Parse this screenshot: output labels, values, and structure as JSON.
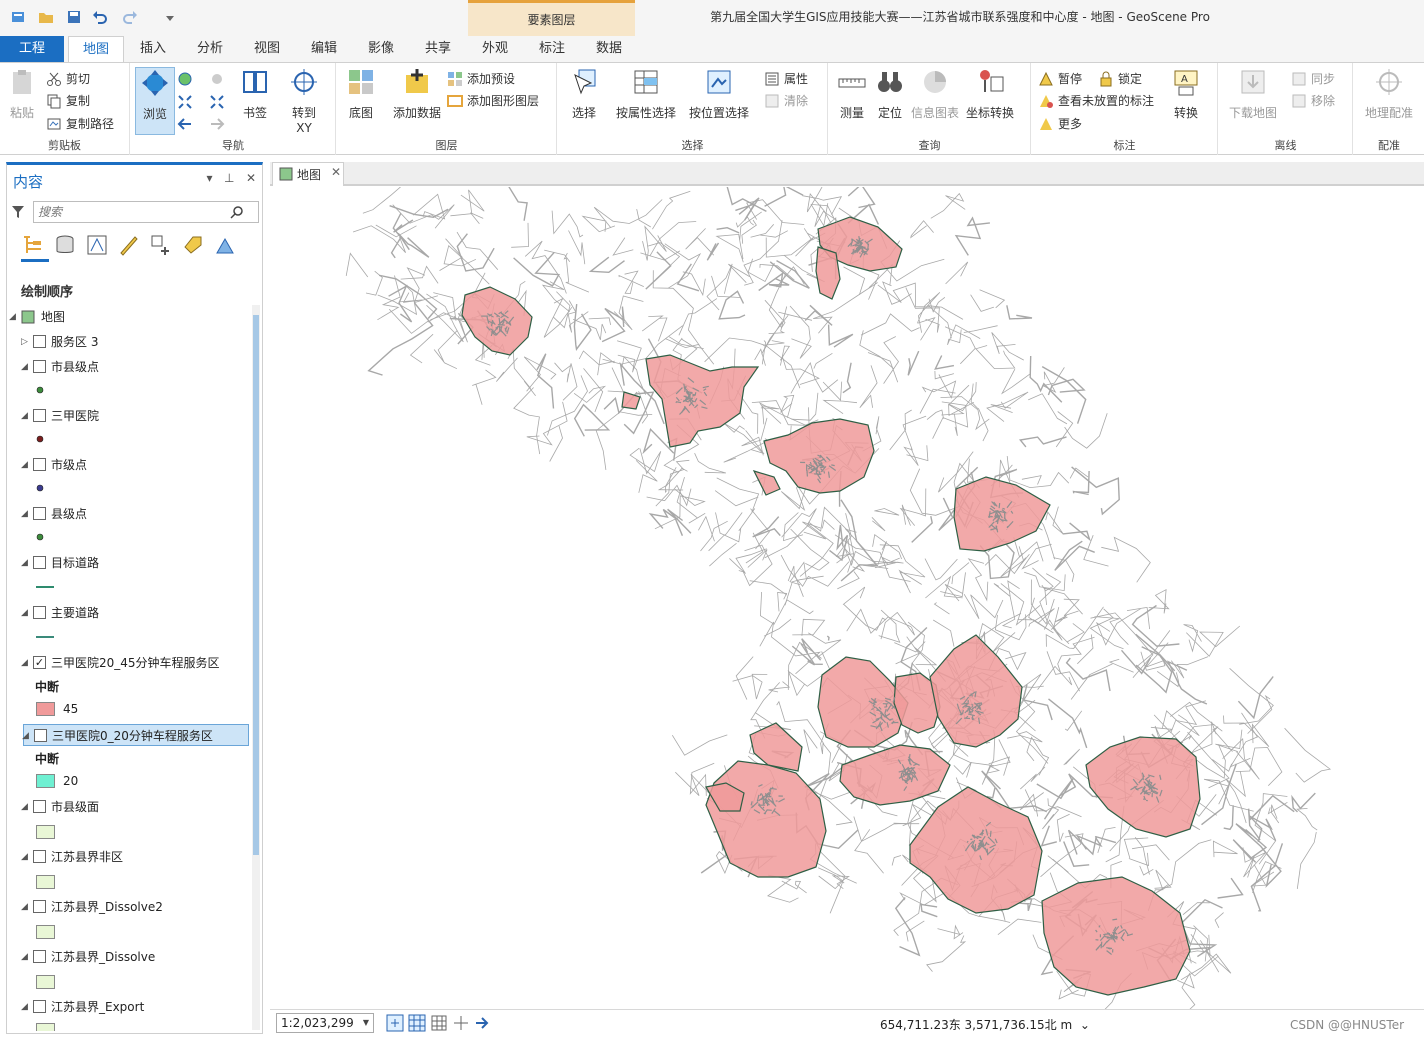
{
  "window": {
    "title": "第九届全国大学生GIS应用技能大赛——江苏省城市联系强度和中心度 - 地图 - GeoScene Pro",
    "contextual_band": "要素图层"
  },
  "tabs": [
    {
      "label": "工程"
    },
    {
      "label": "地图"
    },
    {
      "label": "插入"
    },
    {
      "label": "分析"
    },
    {
      "label": "视图"
    },
    {
      "label": "编辑"
    },
    {
      "label": "影像"
    },
    {
      "label": "共享"
    },
    {
      "label": "外观"
    },
    {
      "label": "标注"
    },
    {
      "label": "数据"
    }
  ],
  "ribbon": {
    "clipboard": {
      "paste": "粘贴",
      "cut": "剪切",
      "copy": "复制",
      "copy_path": "复制路径",
      "group": "剪贴板"
    },
    "navigate": {
      "explore": "浏览",
      "bookmarks": "书签",
      "goto_xy_line1": "转到",
      "goto_xy_line2": "XY",
      "group": "导航"
    },
    "layer": {
      "basemap": "底图",
      "add_data": "添加数据",
      "add_preset": "添加预设",
      "add_graphics": "添加图形图层",
      "group": "图层"
    },
    "selection": {
      "select": "选择",
      "by_attr": "按属性选择",
      "by_loc": "按位置选择",
      "attributes": "属性",
      "clear": "清除",
      "group": "选择"
    },
    "inquiry": {
      "measure": "测量",
      "locate": "定位",
      "infographics": "信息图表",
      "convert_coord": "坐标转换",
      "group": "查询"
    },
    "labeling": {
      "pause": "暂停",
      "lock": "锁定",
      "unplaced": "查看未放置的标注",
      "more": "更多",
      "convert": "转换",
      "group": "标注"
    },
    "offline": {
      "download": "下载地图",
      "sync": "同步",
      "remove": "移除",
      "group": "离线"
    },
    "georef": {
      "georeference": "地理配准",
      "group": "配准"
    }
  },
  "contents": {
    "title": "内容",
    "search_placeholder": "搜索",
    "draw_order": "绘制顺序",
    "map_root": "地图",
    "legend_heading": "中断",
    "layers": [
      {
        "name": "服务区 3",
        "checked": false
      },
      {
        "name": "市县级点",
        "checked": false,
        "symbol_color": "#3d8c3d"
      },
      {
        "name": "三甲医院",
        "checked": false,
        "symbol_color": "#7a1f1f"
      },
      {
        "name": "市级点",
        "checked": false,
        "symbol_color": "#3b3b8f"
      },
      {
        "name": "县级点",
        "checked": false,
        "symbol_color": "#3d8c3d"
      },
      {
        "name": "目标道路",
        "checked": false,
        "symbol_color": "#2e8b6e"
      },
      {
        "name": "主要道路",
        "checked": false,
        "symbol_color": "#3a8a7a"
      },
      {
        "name": "三甲医院20_45分钟车程服务区",
        "checked": true,
        "break_value": "45",
        "symbol_color": "#f09a9a"
      },
      {
        "name": "三甲医院0_20分钟车程服务区",
        "checked": false,
        "break_value": "20",
        "symbol_color": "#6ff0d2"
      },
      {
        "name": "市县级面",
        "checked": false,
        "symbol_color": "#e9f7d6"
      },
      {
        "name": "江苏县界非区",
        "checked": false,
        "symbol_color": "#e9f7d6"
      },
      {
        "name": "江苏县界_Dissolve2",
        "checked": false,
        "symbol_color": "#e9f7d6"
      },
      {
        "name": "江苏县界_Dissolve",
        "checked": false,
        "symbol_color": "#e9f7d6"
      },
      {
        "name": "江苏县界_Export",
        "checked": false,
        "symbol_color": "#e9f7d6"
      }
    ]
  },
  "map_view": {
    "tab_label": "地图",
    "road_color": "#a8a8a8",
    "service_area_color": "#f09a9a",
    "service_area_edge": "#2f5f45"
  },
  "status": {
    "scale": "1:2,023,299",
    "coordinates": "654,711.23东 3,571,736.15北 m",
    "watermark": "CSDN @@HNUSTer"
  },
  "colors": {
    "accent": "#1b6ec2",
    "context_band": "#f7e6c9"
  }
}
